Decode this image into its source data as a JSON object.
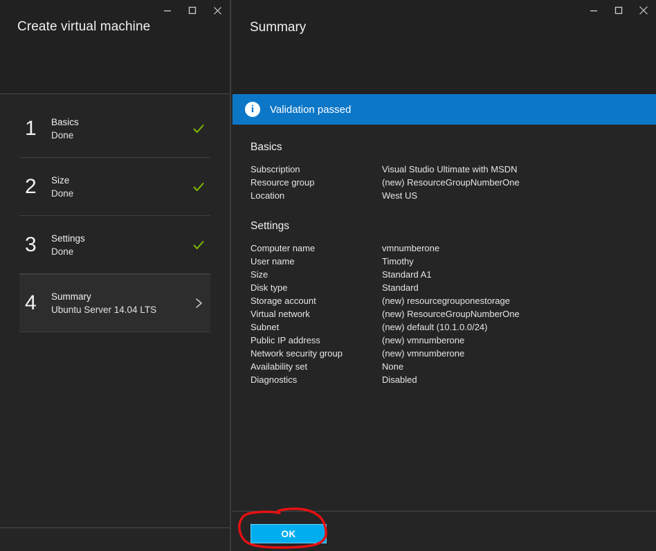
{
  "left_window": {
    "title": "Create virtual machine",
    "window_controls": [
      {
        "name": "minimize",
        "glyph": "minimize-icon"
      },
      {
        "name": "maximize",
        "glyph": "maximize-icon"
      },
      {
        "name": "close",
        "glyph": "close-icon"
      }
    ],
    "steps": [
      {
        "number": "1",
        "title": "Basics",
        "sub": "Done",
        "mark": "check",
        "active": false
      },
      {
        "number": "2",
        "title": "Size",
        "sub": "Done",
        "mark": "check",
        "active": false
      },
      {
        "number": "3",
        "title": "Settings",
        "sub": "Done",
        "mark": "check",
        "active": false
      },
      {
        "number": "4",
        "title": "Summary",
        "sub": "Ubuntu Server 14.04 LTS",
        "mark": "chevron",
        "active": true
      }
    ]
  },
  "right_window": {
    "title": "Summary",
    "window_controls": [
      {
        "name": "minimize",
        "glyph": "minimize-icon"
      },
      {
        "name": "maximize",
        "glyph": "maximize-icon"
      },
      {
        "name": "close",
        "glyph": "close-icon"
      }
    ],
    "validation": {
      "icon": "info-icon",
      "text": "Validation passed"
    },
    "sections": [
      {
        "heading": "Basics",
        "rows": [
          {
            "key": "Subscription",
            "value": "Visual Studio Ultimate with MSDN"
          },
          {
            "key": "Resource group",
            "value": "(new) ResourceGroupNumberOne"
          },
          {
            "key": "Location",
            "value": "West US"
          }
        ]
      },
      {
        "heading": "Settings",
        "rows": [
          {
            "key": "Computer name",
            "value": "vmnumberone"
          },
          {
            "key": "User name",
            "value": "Timothy"
          },
          {
            "key": "Size",
            "value": "Standard A1"
          },
          {
            "key": "Disk type",
            "value": "Standard"
          },
          {
            "key": "Storage account",
            "value": "(new) resourcegrouponestorage"
          },
          {
            "key": "Virtual network",
            "value": "(new) ResourceGroupNumberOne"
          },
          {
            "key": "Subnet",
            "value": "(new) default (10.1.0.0/24)"
          },
          {
            "key": "Public IP address",
            "value": "(new) vmnumberone"
          },
          {
            "key": "Network security group",
            "value": "(new) vmnumberone"
          },
          {
            "key": "Availability set",
            "value": "None"
          },
          {
            "key": "Diagnostics",
            "value": "Disabled"
          }
        ]
      }
    ],
    "footer": {
      "ok_label": "OK"
    }
  },
  "annotation": {
    "shape": "red-ellipse-highlight",
    "color": "#e81010",
    "targets": "ok-button"
  },
  "colors": {
    "accent_blue": "#0d77c7",
    "ok_blue": "#00aeef",
    "check_green": "#7fba00",
    "tab_orange": "#f28c00",
    "panel_bg": "#252526",
    "titlebar_bg": "#212121",
    "annotation_red": "#e81010"
  }
}
